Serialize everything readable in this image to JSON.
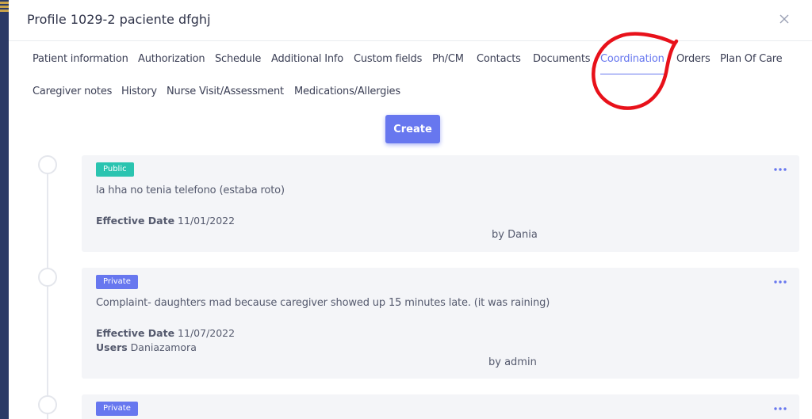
{
  "modal": {
    "title": "Profile 1029-2 paciente dfghj"
  },
  "tabs": [
    {
      "label": "Patient information"
    },
    {
      "label": "Authorization"
    },
    {
      "label": "Schedule"
    },
    {
      "label": "Additional Info"
    },
    {
      "label": "Custom fields"
    },
    {
      "label": "Ph/CM"
    },
    {
      "label": "Contacts"
    },
    {
      "label": "Documents"
    },
    {
      "label": "Coordination",
      "active": true
    },
    {
      "label": "Orders"
    },
    {
      "label": "Plan Of Care"
    },
    {
      "label": "Caregiver notes"
    },
    {
      "label": "History"
    },
    {
      "label": "Nurse Visit/Assessment"
    },
    {
      "label": "Medications/Allergies"
    }
  ],
  "actions": {
    "create_label": "Create"
  },
  "notes": [
    {
      "visibility": "Public",
      "text": "la hha no tenia telefono (estaba roto)",
      "effective_date_label": "Effective Date",
      "effective_date": "11/01/2022",
      "by": "by Dania"
    },
    {
      "visibility": "Private",
      "text": "Complaint- daughters mad because caregiver showed up 15 minutes late. (it was raining)",
      "effective_date_label": "Effective Date",
      "effective_date": "11/07/2022",
      "users_label": "Users",
      "users": "Daniazamora",
      "by": "by admin"
    },
    {
      "visibility": "Private"
    }
  ],
  "colors": {
    "accent": "#6777ef",
    "public_badge": "#2bc4b0",
    "annotation": "#e8111a"
  }
}
